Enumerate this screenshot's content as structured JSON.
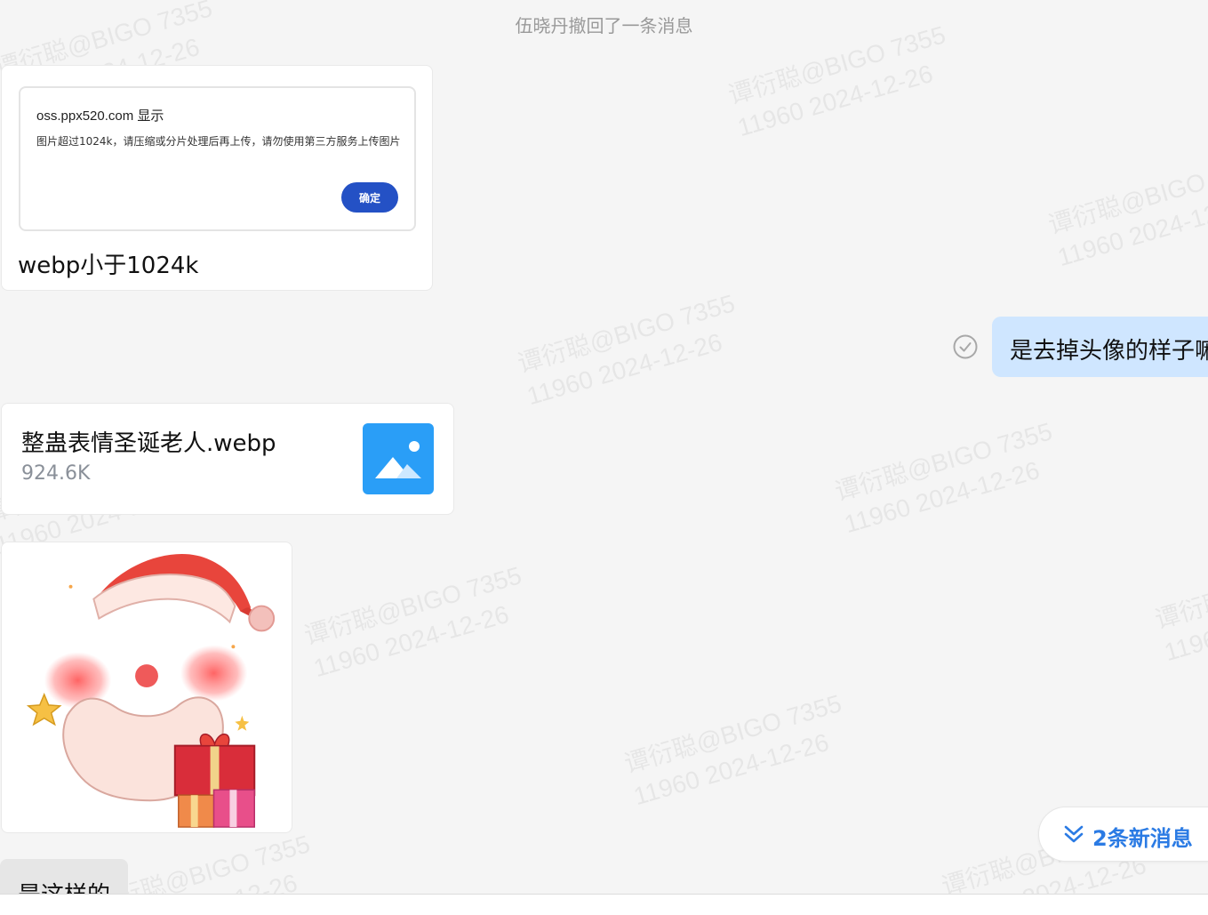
{
  "watermark": {
    "line1": "谭衍聪@BIGO 7355",
    "line2": "11960 2024-12-26"
  },
  "system_notice": "伍晓丹撤回了一条消息",
  "screenshot_message": {
    "dialog": {
      "title": "oss.ppx520.com 显示",
      "body": "图片超过1024k，请压缩或分片处理后再上传，请勿使用第三方服务上传图片",
      "ok_button": "确定"
    },
    "caption": "webp小于1024k"
  },
  "outgoing_message": {
    "text": "是去掉头像的样子嘛",
    "status_icon": "check-circle-icon"
  },
  "file_message": {
    "name": "整蛊表情圣诞老人.webp",
    "size": "924.6K",
    "icon": "image-file-icon"
  },
  "sticker_message": {
    "icon": "santa-sticker-image"
  },
  "incoming_message": {
    "text": "是这样的"
  },
  "new_messages_pill": {
    "label": "2条新消息",
    "icon": "double-chevron-down-icon"
  },
  "colors": {
    "accent": "#2b7be4",
    "outgoing_bubble": "#cfe6ff",
    "dialog_button": "#2451c5",
    "file_icon": "#2a9ef7"
  }
}
